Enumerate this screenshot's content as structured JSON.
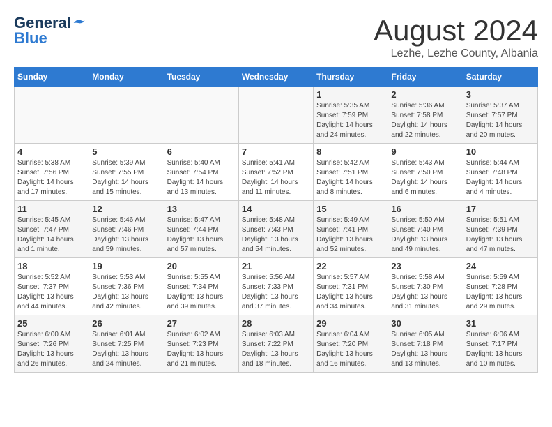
{
  "header": {
    "logo_general": "General",
    "logo_blue": "Blue",
    "month_title": "August 2024",
    "subtitle": "Lezhe, Lezhe County, Albania"
  },
  "days_of_week": [
    "Sunday",
    "Monday",
    "Tuesday",
    "Wednesday",
    "Thursday",
    "Friday",
    "Saturday"
  ],
  "weeks": [
    [
      {
        "day": "",
        "info": ""
      },
      {
        "day": "",
        "info": ""
      },
      {
        "day": "",
        "info": ""
      },
      {
        "day": "",
        "info": ""
      },
      {
        "day": "1",
        "info": "Sunrise: 5:35 AM\nSunset: 7:59 PM\nDaylight: 14 hours and 24 minutes."
      },
      {
        "day": "2",
        "info": "Sunrise: 5:36 AM\nSunset: 7:58 PM\nDaylight: 14 hours and 22 minutes."
      },
      {
        "day": "3",
        "info": "Sunrise: 5:37 AM\nSunset: 7:57 PM\nDaylight: 14 hours and 20 minutes."
      }
    ],
    [
      {
        "day": "4",
        "info": "Sunrise: 5:38 AM\nSunset: 7:56 PM\nDaylight: 14 hours and 17 minutes."
      },
      {
        "day": "5",
        "info": "Sunrise: 5:39 AM\nSunset: 7:55 PM\nDaylight: 14 hours and 15 minutes."
      },
      {
        "day": "6",
        "info": "Sunrise: 5:40 AM\nSunset: 7:54 PM\nDaylight: 14 hours and 13 minutes."
      },
      {
        "day": "7",
        "info": "Sunrise: 5:41 AM\nSunset: 7:52 PM\nDaylight: 14 hours and 11 minutes."
      },
      {
        "day": "8",
        "info": "Sunrise: 5:42 AM\nSunset: 7:51 PM\nDaylight: 14 hours and 8 minutes."
      },
      {
        "day": "9",
        "info": "Sunrise: 5:43 AM\nSunset: 7:50 PM\nDaylight: 14 hours and 6 minutes."
      },
      {
        "day": "10",
        "info": "Sunrise: 5:44 AM\nSunset: 7:48 PM\nDaylight: 14 hours and 4 minutes."
      }
    ],
    [
      {
        "day": "11",
        "info": "Sunrise: 5:45 AM\nSunset: 7:47 PM\nDaylight: 14 hours and 1 minute."
      },
      {
        "day": "12",
        "info": "Sunrise: 5:46 AM\nSunset: 7:46 PM\nDaylight: 13 hours and 59 minutes."
      },
      {
        "day": "13",
        "info": "Sunrise: 5:47 AM\nSunset: 7:44 PM\nDaylight: 13 hours and 57 minutes."
      },
      {
        "day": "14",
        "info": "Sunrise: 5:48 AM\nSunset: 7:43 PM\nDaylight: 13 hours and 54 minutes."
      },
      {
        "day": "15",
        "info": "Sunrise: 5:49 AM\nSunset: 7:41 PM\nDaylight: 13 hours and 52 minutes."
      },
      {
        "day": "16",
        "info": "Sunrise: 5:50 AM\nSunset: 7:40 PM\nDaylight: 13 hours and 49 minutes."
      },
      {
        "day": "17",
        "info": "Sunrise: 5:51 AM\nSunset: 7:39 PM\nDaylight: 13 hours and 47 minutes."
      }
    ],
    [
      {
        "day": "18",
        "info": "Sunrise: 5:52 AM\nSunset: 7:37 PM\nDaylight: 13 hours and 44 minutes."
      },
      {
        "day": "19",
        "info": "Sunrise: 5:53 AM\nSunset: 7:36 PM\nDaylight: 13 hours and 42 minutes."
      },
      {
        "day": "20",
        "info": "Sunrise: 5:55 AM\nSunset: 7:34 PM\nDaylight: 13 hours and 39 minutes."
      },
      {
        "day": "21",
        "info": "Sunrise: 5:56 AM\nSunset: 7:33 PM\nDaylight: 13 hours and 37 minutes."
      },
      {
        "day": "22",
        "info": "Sunrise: 5:57 AM\nSunset: 7:31 PM\nDaylight: 13 hours and 34 minutes."
      },
      {
        "day": "23",
        "info": "Sunrise: 5:58 AM\nSunset: 7:30 PM\nDaylight: 13 hours and 31 minutes."
      },
      {
        "day": "24",
        "info": "Sunrise: 5:59 AM\nSunset: 7:28 PM\nDaylight: 13 hours and 29 minutes."
      }
    ],
    [
      {
        "day": "25",
        "info": "Sunrise: 6:00 AM\nSunset: 7:26 PM\nDaylight: 13 hours and 26 minutes."
      },
      {
        "day": "26",
        "info": "Sunrise: 6:01 AM\nSunset: 7:25 PM\nDaylight: 13 hours and 24 minutes."
      },
      {
        "day": "27",
        "info": "Sunrise: 6:02 AM\nSunset: 7:23 PM\nDaylight: 13 hours and 21 minutes."
      },
      {
        "day": "28",
        "info": "Sunrise: 6:03 AM\nSunset: 7:22 PM\nDaylight: 13 hours and 18 minutes."
      },
      {
        "day": "29",
        "info": "Sunrise: 6:04 AM\nSunset: 7:20 PM\nDaylight: 13 hours and 16 minutes."
      },
      {
        "day": "30",
        "info": "Sunrise: 6:05 AM\nSunset: 7:18 PM\nDaylight: 13 hours and 13 minutes."
      },
      {
        "day": "31",
        "info": "Sunrise: 6:06 AM\nSunset: 7:17 PM\nDaylight: 13 hours and 10 minutes."
      }
    ]
  ]
}
